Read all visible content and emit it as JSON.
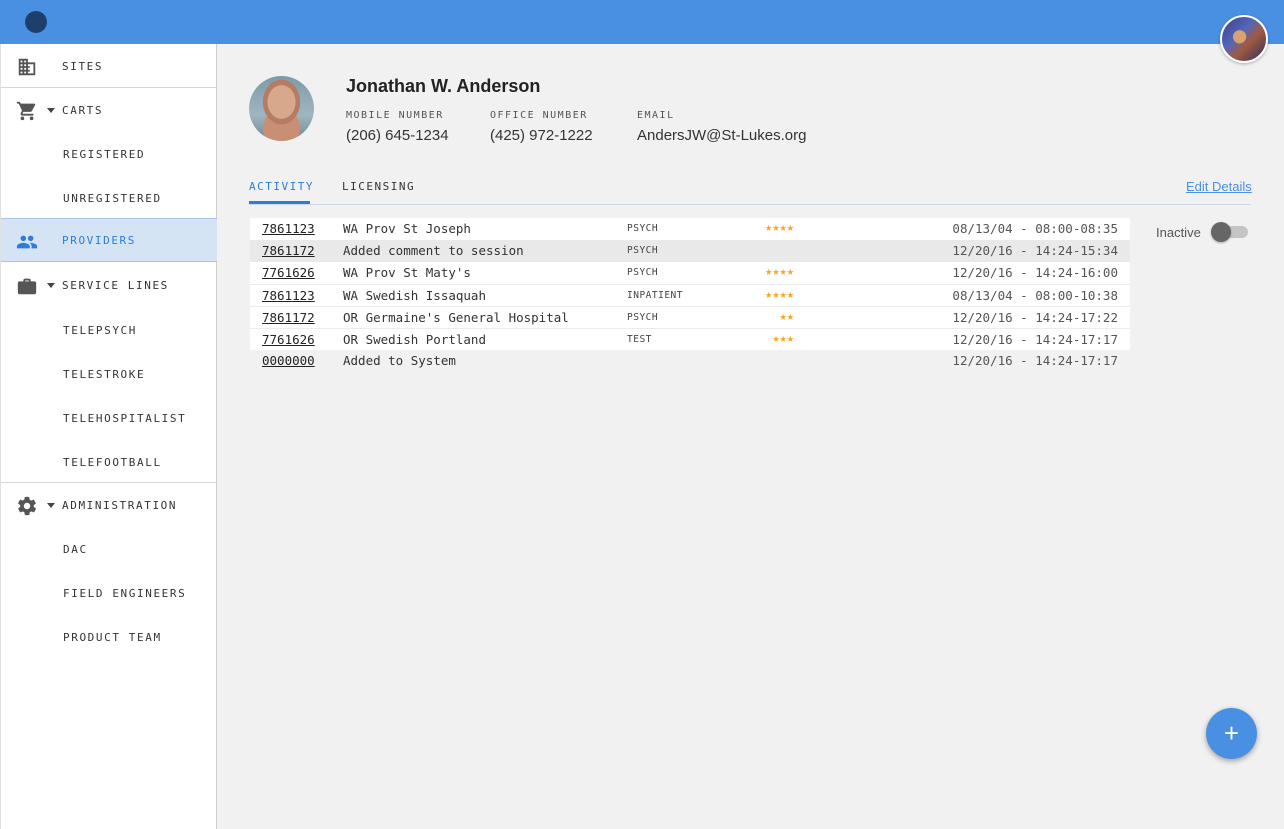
{
  "colors": {
    "topbar": "#4a90e2",
    "accent": "#2f7bd6",
    "star": "#f5a623",
    "active_nav_bg": "#d4e4f5"
  },
  "header": {
    "logo_icon": "circle-logo-icon",
    "avatar_icon": "user-avatar"
  },
  "sidebar": {
    "sites": "SITES",
    "carts": "CARTS",
    "registered": "REGISTERED",
    "unregistered": "UNREGISTERED",
    "providers": "PROVIDERS",
    "service_lines": "SERVICE LINES",
    "telepsych": "TELEPSYCH",
    "telestroke": "TELESTROKE",
    "telehospitalist": "TELEHOSPITALIST",
    "telefootball": "TELEFOOTBALL",
    "administration": "ADMINISTRATION",
    "dac": "DAC",
    "field_engineers": "FIELD ENGINEERS",
    "product_team": "PRODUCT TEAM"
  },
  "profile": {
    "name": "Jonathan W. Anderson",
    "mobile_label": "MOBILE NUMBER",
    "mobile": "(206) 645-1234",
    "office_label": "OFFICE NUMBER",
    "office": "(425) 972-1222",
    "email_label": "EMAIL",
    "email": "AndersJW@St-Lukes.org"
  },
  "tabs": {
    "activity": "ACTIVITY",
    "licensing": "LICENSING",
    "edit": "Edit Details"
  },
  "status": {
    "inactive_label": "Inactive",
    "active": false
  },
  "activity": [
    {
      "id": "7861123",
      "desc": "WA Prov St Joseph",
      "type": "PSYCH",
      "stars": "★★★★",
      "rating": 4,
      "time": "08/13/04 - 08:00-08:35"
    },
    {
      "id": "7861172",
      "desc": "Added comment to session",
      "type": "PSYCH",
      "stars": "",
      "rating": 0,
      "time": "12/20/16 - 14:24-15:34"
    },
    {
      "id": "7761626",
      "desc": "WA Prov St Maty's",
      "type": "PSYCH",
      "stars": "★★★★",
      "rating": 4,
      "time": "12/20/16 - 14:24-16:00"
    },
    {
      "id": "7861123",
      "desc": "WA Swedish Issaquah",
      "type": "INPATIENT",
      "stars": "★★★★",
      "rating": 4,
      "time": "08/13/04 - 08:00-10:38"
    },
    {
      "id": "7861172",
      "desc": "OR Germaine's General Hospital",
      "type": "PSYCH",
      "stars": "★★",
      "rating": 2,
      "time": "12/20/16 - 14:24-17:22"
    },
    {
      "id": "7761626",
      "desc": "OR Swedish Portland",
      "type": "TEST",
      "stars": "★★★",
      "rating": 3,
      "time": "12/20/16 - 14:24-17:17"
    },
    {
      "id": "0000000",
      "desc": "Added to System",
      "type": "",
      "stars": "",
      "rating": 0,
      "time": "12/20/16 - 14:24-17:17"
    }
  ],
  "fab": {
    "label": "+"
  }
}
